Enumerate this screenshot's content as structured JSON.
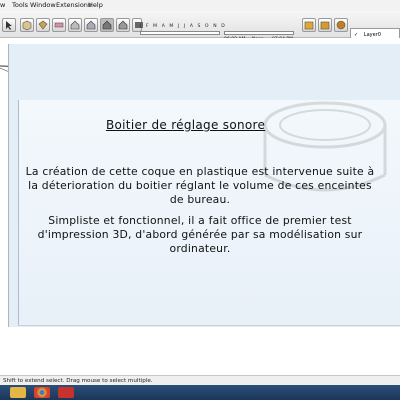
{
  "menubar": {
    "items": [
      "w",
      "Tools",
      "Window",
      "Extensions",
      "Help"
    ]
  },
  "toolbar": {
    "months": "J F M A M J J A S O N D",
    "time_morning": "06:09 AM",
    "time_noon": "Noon",
    "time_evening": "07:04 PM",
    "layer": "Layer0",
    "layer_check": "✓"
  },
  "slide": {
    "title": "Boitier de réglage sonore",
    "paragraph1": "La création de cette coque en plastique est intervenue suite à la déterioration du boitier réglant le volume de ces enceintes de bureau.",
    "paragraph2": "Simpliste et fonctionnel, il a fait office de premier test d'impression 3D, d'abord générée par sa modélisation sur ordinateur."
  },
  "status": {
    "text": "Shift to extend select. Drag mouse to select multiple."
  },
  "taskbar": {
    "apps": [
      "explorer-icon",
      "chrome-icon",
      "sketchup-icon"
    ]
  },
  "colors": {
    "accent": "#2c4f79",
    "slide_bg": "#eaf2fa"
  }
}
